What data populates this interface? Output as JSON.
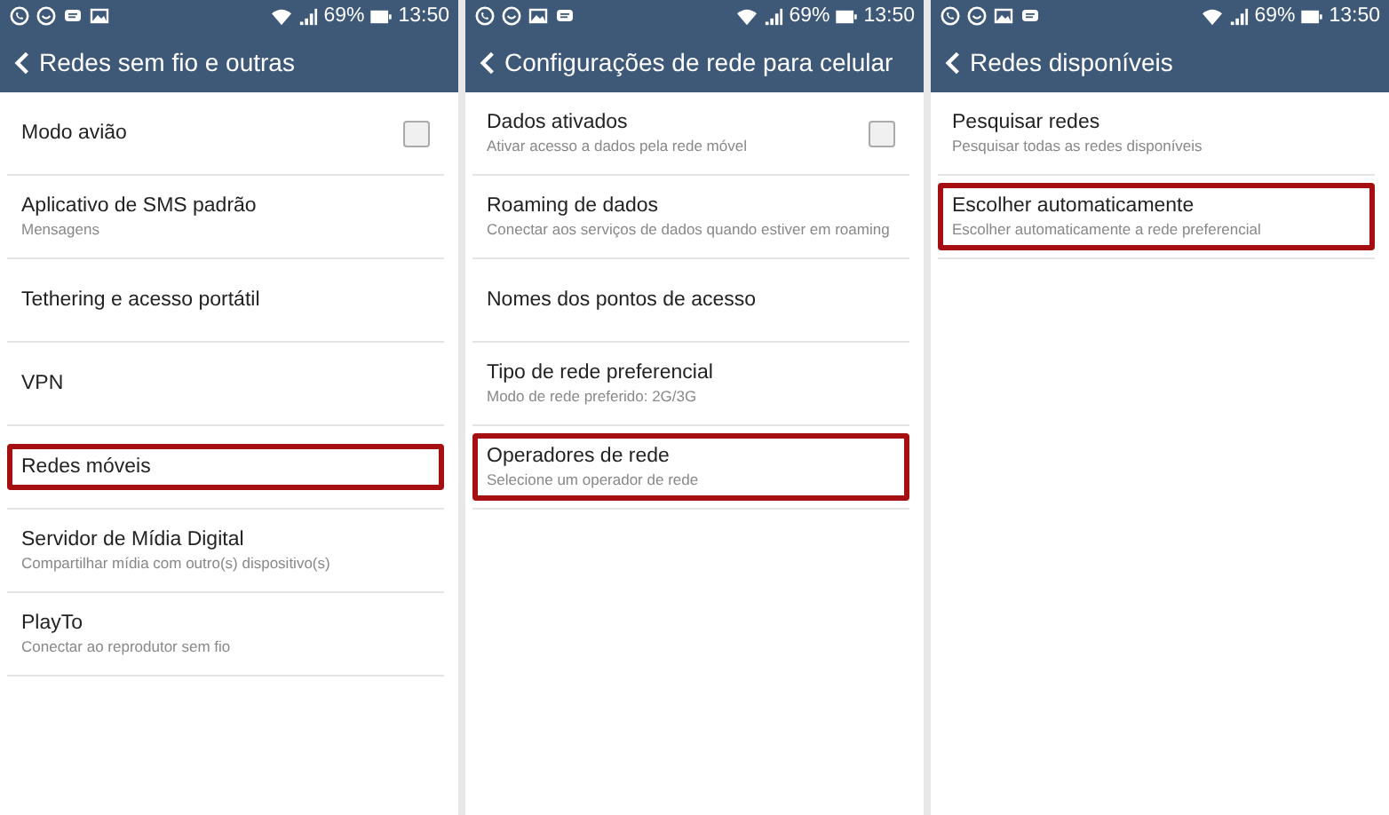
{
  "screens": [
    {
      "status_bar": {
        "notifications": [
          {
            "kind": "phone-bubble"
          },
          {
            "kind": "smile-bubble"
          },
          {
            "kind": "message"
          },
          {
            "kind": "image"
          }
        ],
        "battery": "69%",
        "time": "13:50"
      },
      "title": "Redes sem fio e outras",
      "items": [
        {
          "kind": "checkbox",
          "title": "Modo avião",
          "checked": false,
          "highlighted": false
        },
        {
          "kind": "plain",
          "title": "Aplicativo de SMS padrão",
          "subtitle": "Mensagens",
          "highlighted": false
        },
        {
          "kind": "plain",
          "title": "Tethering e acesso portátil",
          "highlighted": false
        },
        {
          "kind": "plain",
          "title": "VPN",
          "highlighted": false
        },
        {
          "kind": "plain",
          "title": "Redes móveis",
          "highlighted": true
        },
        {
          "kind": "plain",
          "title": "Servidor de Mídia Digital",
          "subtitle": "Compartilhar mídia com outro(s) dispositivo(s)",
          "highlighted": false
        },
        {
          "kind": "plain",
          "title": "PlayTo",
          "subtitle": "Conectar ao reprodutor sem fio",
          "highlighted": false
        }
      ]
    },
    {
      "status_bar": {
        "notifications": [
          {
            "kind": "phone-bubble"
          },
          {
            "kind": "smile-bubble"
          },
          {
            "kind": "image"
          },
          {
            "kind": "message"
          }
        ],
        "battery": "69%",
        "time": "13:50"
      },
      "title": "Configurações de rede para celular",
      "items": [
        {
          "kind": "checkbox",
          "title": "Dados ativados",
          "subtitle": "Ativar acesso a dados pela rede móvel",
          "checked": false,
          "highlighted": false
        },
        {
          "kind": "plain",
          "title": "Roaming de dados",
          "subtitle": "Conectar aos serviços de dados quando estiver em roaming",
          "highlighted": false
        },
        {
          "kind": "plain",
          "title": "Nomes dos pontos de acesso",
          "highlighted": false
        },
        {
          "kind": "plain",
          "title": "Tipo de rede preferencial",
          "subtitle": "Modo de rede preferido: 2G/3G",
          "highlighted": false
        },
        {
          "kind": "plain",
          "title": "Operadores de rede",
          "subtitle": "Selecione um operador de rede",
          "highlighted": true
        }
      ]
    },
    {
      "status_bar": {
        "notifications": [
          {
            "kind": "phone-bubble"
          },
          {
            "kind": "smile-bubble"
          },
          {
            "kind": "image"
          },
          {
            "kind": "message"
          }
        ],
        "battery": "69%",
        "time": "13:50"
      },
      "title": "Redes disponíveis",
      "items": [
        {
          "kind": "plain",
          "title": "Pesquisar redes",
          "subtitle": "Pesquisar todas as redes disponíveis",
          "highlighted": false
        },
        {
          "kind": "plain",
          "title": "Escolher automaticamente",
          "subtitle": "Escolher automaticamente a rede preferencial",
          "highlighted": true
        }
      ]
    }
  ]
}
